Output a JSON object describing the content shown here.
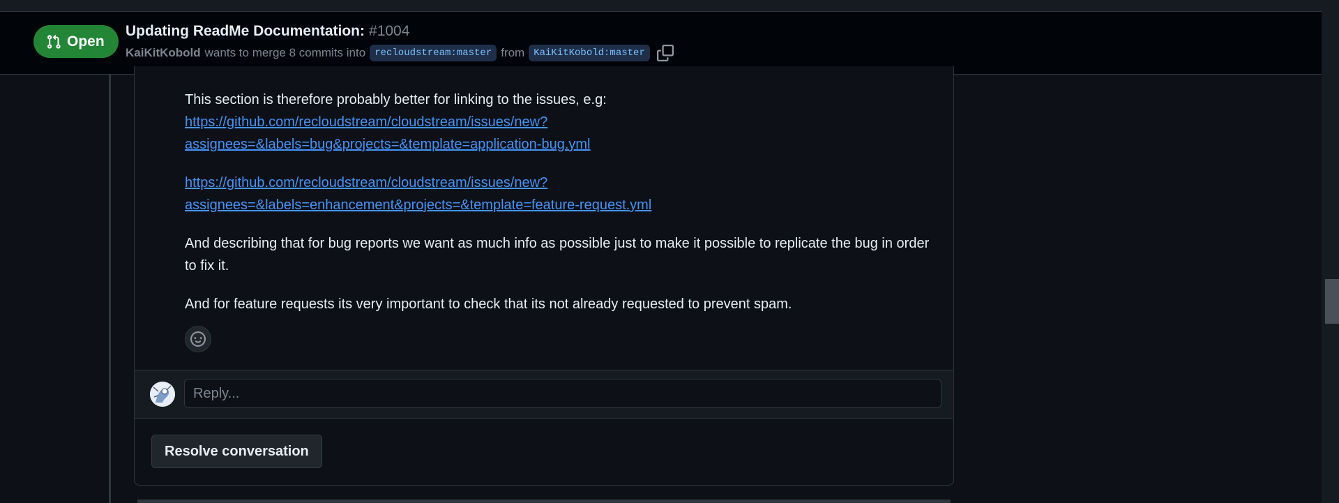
{
  "header": {
    "state_label": "Open",
    "state_color": "#238636",
    "title": "Updating ReadMe Documentation:",
    "number": "#1004",
    "author": "KaiKitKobold",
    "merge_text": "wants to merge 8 commits into",
    "base_branch": "recloudstream:master",
    "from_text": "from",
    "head_branch": "KaiKitKobold:master"
  },
  "comment": {
    "p1": "This section is therefore probably better for linking to the issues, e.g:",
    "link1_line1": "https://github.com/recloudstream/cloudstream/issues/new?",
    "link1_line2": "assignees=&labels=bug&projects=&template=application-bug.yml",
    "link2_line1": "https://github.com/recloudstream/cloudstream/issues/new?",
    "link2_line2": "assignees=&labels=enhancement&projects=&template=feature-request.yml",
    "p3": "And describing that for bug reports we want as much info as possible just to make it possible to replicate the bug in order to fix it.",
    "p4": "And for feature requests its very important to check that its not already requested to prevent spam."
  },
  "reply": {
    "placeholder": "Reply..."
  },
  "actions": {
    "resolve_label": "Resolve conversation"
  },
  "colors": {
    "link": "#4493f8",
    "background": "#0d1117",
    "branch_text": "#79c0ff"
  },
  "icons": {
    "state": "git-pull-request-icon",
    "copy": "copy-icon",
    "reaction": "smiley-icon"
  }
}
